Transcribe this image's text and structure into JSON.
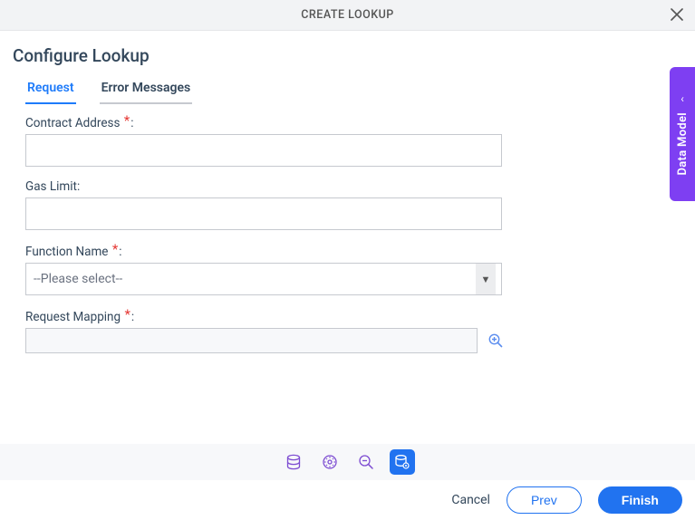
{
  "titlebar": {
    "title": "CREATE LOOKUP"
  },
  "heading": "Configure Lookup",
  "tabs": {
    "request": "Request",
    "error": "Error Messages"
  },
  "form": {
    "contract_label": "Contract Address",
    "gas_label": "Gas Limit:",
    "function_label": "Function Name",
    "function_selected": "--Please select--",
    "mapping_label": "Request Mapping"
  },
  "footer": {
    "cancel": "Cancel",
    "prev": "Prev",
    "finish": "Finish"
  },
  "sidetab": {
    "label": "Data Model"
  }
}
